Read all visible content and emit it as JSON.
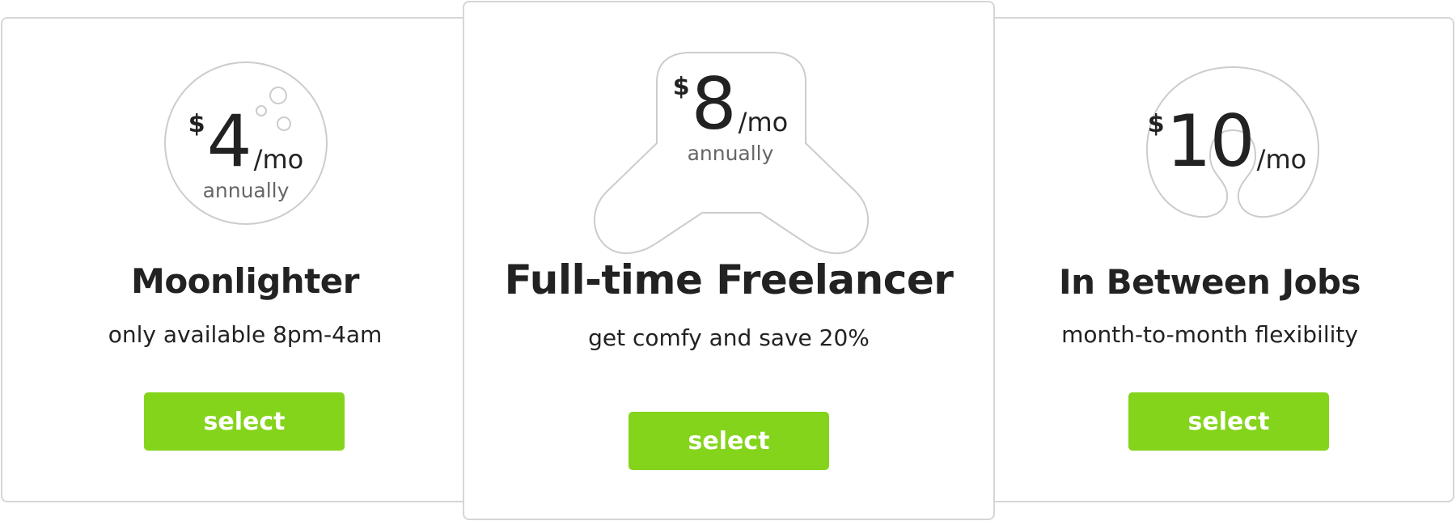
{
  "brand": {
    "button_color": "#84d41b",
    "border_color": "#d6d6d6",
    "icon_stroke": "#cccccc"
  },
  "plans": [
    {
      "currency": "$",
      "amount": "4",
      "period": "/mo",
      "billing": "annually",
      "name": "Moonlighter",
      "tagline": "only available 8pm-4am",
      "button_label": "select",
      "icon": "moon-icon"
    },
    {
      "currency": "$",
      "amount": "8",
      "period": "/mo",
      "billing": "annually",
      "name": "Full-time Freelancer",
      "tagline": "get comfy and save 20%",
      "button_label": "select",
      "icon": "armchair-pillow-icon"
    },
    {
      "currency": "$",
      "amount": "10",
      "period": "/mo",
      "billing": "",
      "name": "In Between Jobs",
      "tagline": "month-to-month flexibility",
      "button_label": "select",
      "icon": "neck-pillow-icon"
    }
  ]
}
